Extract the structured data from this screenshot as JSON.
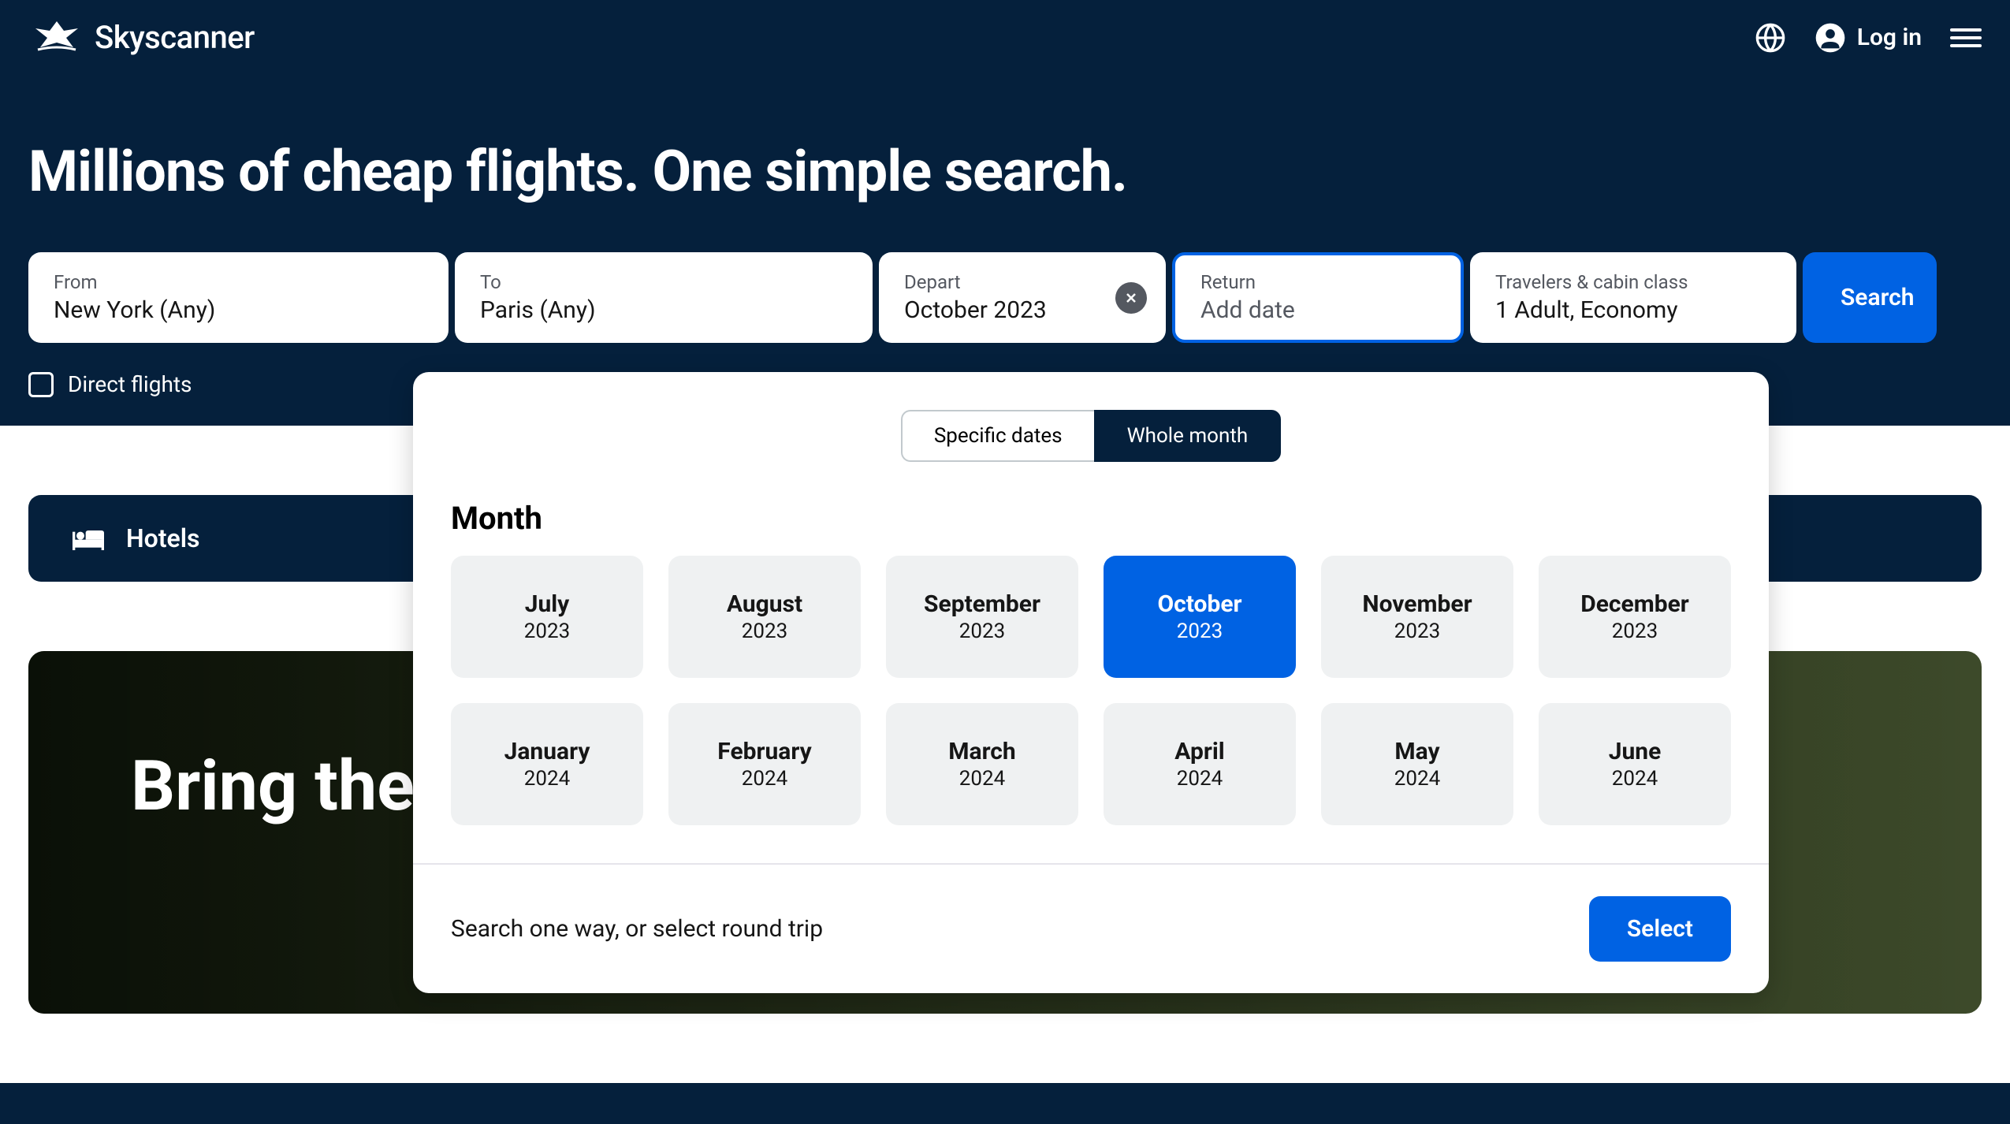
{
  "header": {
    "logo_text": "Skyscanner",
    "login_label": "Log in"
  },
  "hero": {
    "title": "Millions of cheap flights. One simple search."
  },
  "search": {
    "from": {
      "label": "From",
      "value": "New York (Any)"
    },
    "to": {
      "label": "To",
      "value": "Paris (Any)"
    },
    "depart": {
      "label": "Depart",
      "value": "October 2023"
    },
    "return": {
      "label": "Return",
      "placeholder": "Add date"
    },
    "travelers": {
      "label": "Travelers & cabin class",
      "value": "1 Adult, Economy"
    },
    "search_button": "Search",
    "direct_flights_label": "Direct flights"
  },
  "datepicker": {
    "tabs": {
      "specific": "Specific dates",
      "whole": "Whole month"
    },
    "month_label": "Month",
    "months": [
      {
        "name": "July",
        "year": "2023",
        "selected": false
      },
      {
        "name": "August",
        "year": "2023",
        "selected": false
      },
      {
        "name": "September",
        "year": "2023",
        "selected": false
      },
      {
        "name": "October",
        "year": "2023",
        "selected": true
      },
      {
        "name": "November",
        "year": "2023",
        "selected": false
      },
      {
        "name": "December",
        "year": "2023",
        "selected": false
      },
      {
        "name": "January",
        "year": "2024",
        "selected": false
      },
      {
        "name": "February",
        "year": "2024",
        "selected": false
      },
      {
        "name": "March",
        "year": "2024",
        "selected": false
      },
      {
        "name": "April",
        "year": "2024",
        "selected": false
      },
      {
        "name": "May",
        "year": "2024",
        "selected": false
      },
      {
        "name": "June",
        "year": "2024",
        "selected": false
      }
    ],
    "footer_text": "Search one way, or select round trip",
    "select_button": "Select"
  },
  "below": {
    "hotels_label": "Hotels",
    "promo_title": "Bring the"
  }
}
